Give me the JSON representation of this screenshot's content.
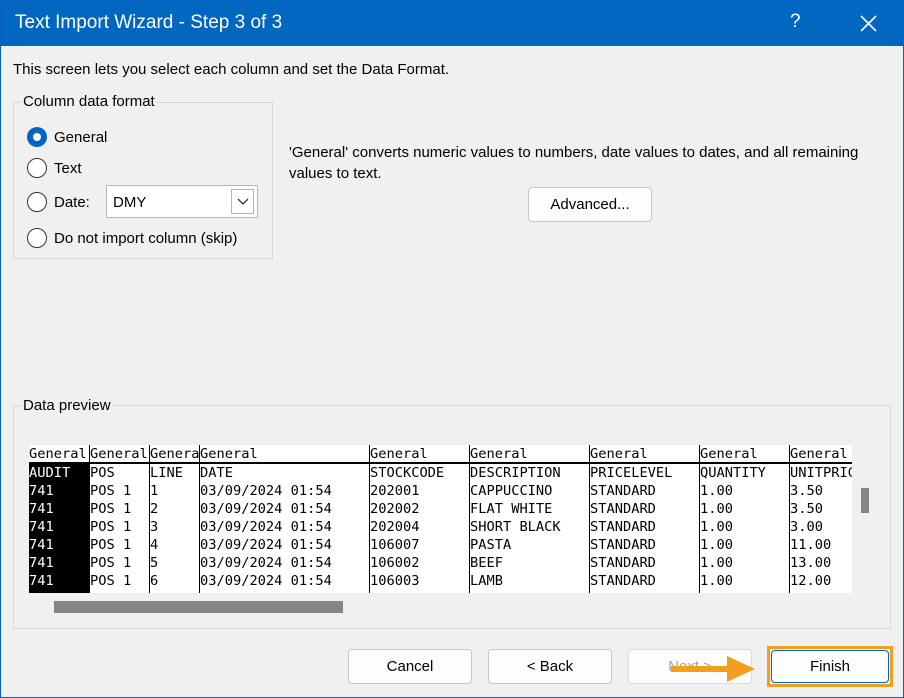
{
  "window": {
    "title": "Text Import Wizard - Step 3 of 3",
    "help_label": "?",
    "close_icon": "close-icon",
    "titlebar_color": "#0067c0"
  },
  "intro_text": "This screen lets you select each column and set the Data Format.",
  "column_format": {
    "group_label": "Column data format",
    "options": [
      {
        "label": "General",
        "selected": true
      },
      {
        "label": "Text",
        "selected": false
      },
      {
        "label": "Date:",
        "selected": false
      },
      {
        "label": "Do not import column (skip)",
        "selected": false
      }
    ],
    "date_format_value": "DMY"
  },
  "description": "'General' converts numeric values to numbers, date values to dates, and all remaining values to text.",
  "advanced_button": "Advanced...",
  "data_preview": {
    "group_label": "Data preview",
    "columns": [
      {
        "header": "General",
        "cells": [
          "AUDIT",
          "741",
          "741",
          "741",
          "741",
          "741",
          "741"
        ]
      },
      {
        "header": "General",
        "cells": [
          "POS",
          "POS 1",
          "POS 1",
          "POS 1",
          "POS 1",
          "POS 1",
          "POS 1"
        ]
      },
      {
        "header": "General",
        "cells": [
          "LINE",
          "1",
          "2",
          "3",
          "4",
          "5",
          "6"
        ]
      },
      {
        "header": "General",
        "cells": [
          "DATE",
          "03/09/2024 01:54",
          "03/09/2024 01:54",
          "03/09/2024 01:54",
          "03/09/2024 01:54",
          "03/09/2024 01:54",
          "03/09/2024 01:54"
        ]
      },
      {
        "header": "General",
        "cells": [
          "STOCKCODE",
          "202001",
          "202002",
          "202004",
          "106007",
          "106002",
          "106003"
        ]
      },
      {
        "header": "General",
        "cells": [
          "DESCRIPTION",
          "CAPPUCCINO",
          "FLAT WHITE",
          "SHORT BLACK",
          "PASTA",
          "BEEF",
          "LAMB"
        ]
      },
      {
        "header": "General",
        "cells": [
          "PRICELEVEL",
          "STANDARD",
          "STANDARD",
          "STANDARD",
          "STANDARD",
          "STANDARD",
          "STANDARD"
        ]
      },
      {
        "header": "General",
        "cells": [
          "QUANTITY",
          "1.00",
          "1.00",
          "1.00",
          "1.00",
          "1.00",
          "1.00"
        ]
      },
      {
        "header": "General",
        "cells": [
          "UNITPRICE",
          "3.50",
          "3.50",
          "3.00",
          "11.00",
          "13.00",
          "12.00"
        ]
      }
    ]
  },
  "buttons": {
    "cancel": "Cancel",
    "back": "< Back",
    "next": "Next >",
    "finish": "Finish"
  },
  "annotation": {
    "arrow_color": "#f0a01e",
    "highlight_color": "#f0a01e"
  }
}
